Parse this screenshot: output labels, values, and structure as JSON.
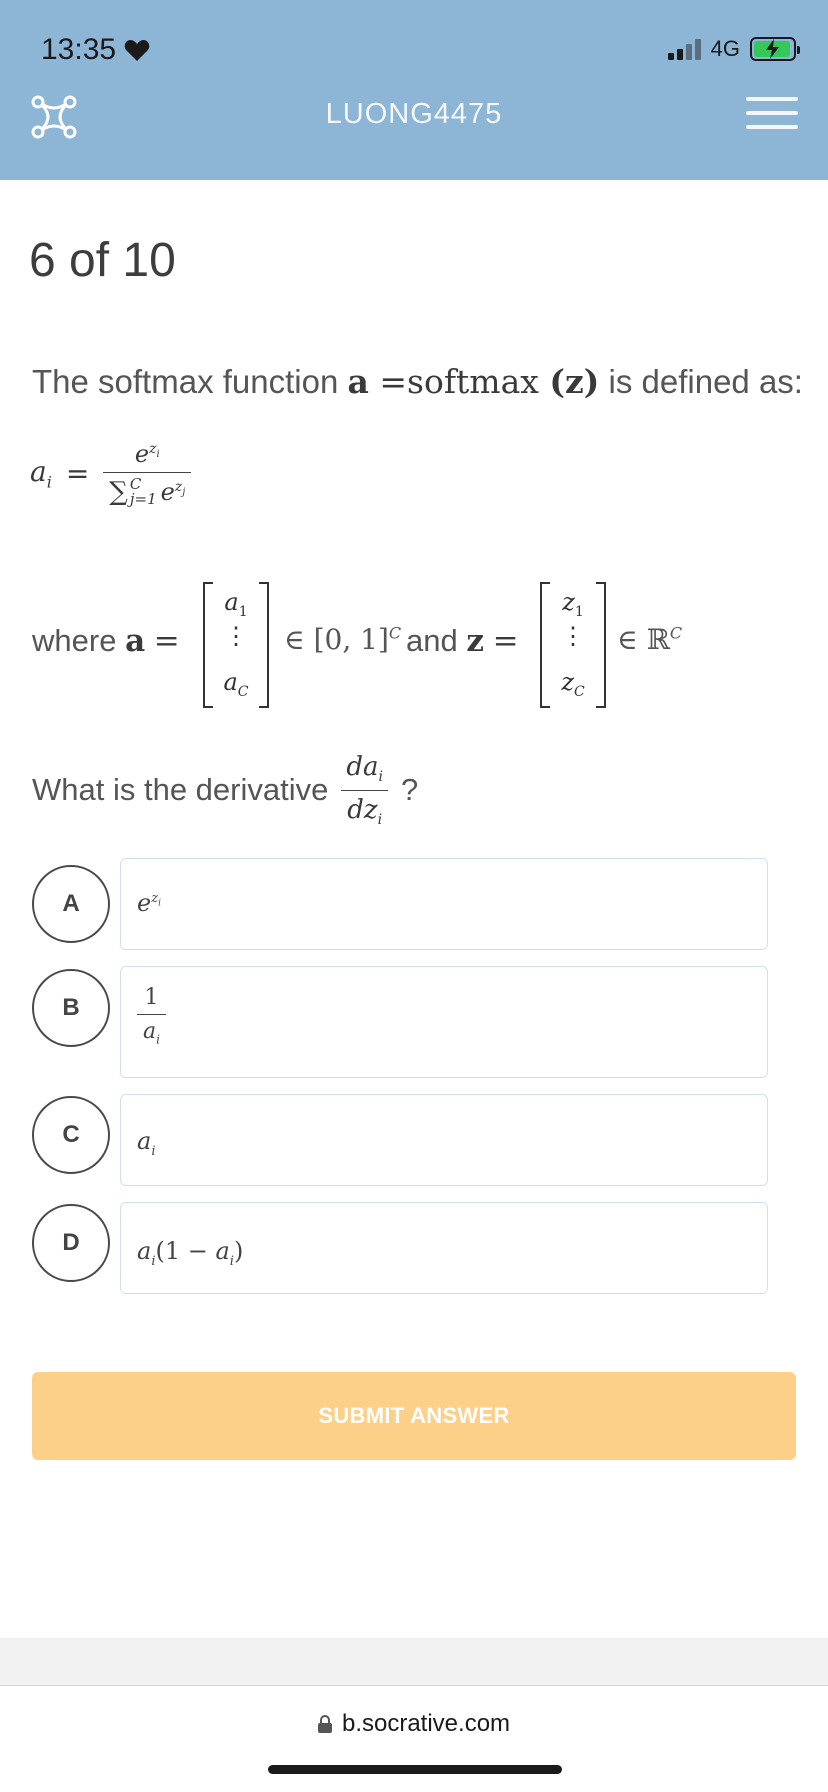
{
  "status_bar": {
    "time": "13:35",
    "network": "4G"
  },
  "header": {
    "title": "LUONG4475"
  },
  "progress_label": "6 of 10",
  "question": {
    "intro_prefix": "The softmax function ",
    "intro_a": "a",
    "intro_eq": " =softmax ",
    "intro_z": "(z)",
    "intro_suffix": " is defined as:",
    "formula_lhs": "a",
    "formula_lhs_sub": "i",
    "formula_eq": "=",
    "formula_num": "e",
    "formula_num_sup": "z",
    "formula_num_sup_sub": "i",
    "formula_sum": "∑",
    "formula_sum_top": "C",
    "formula_sum_bottom": "j=1",
    "formula_den_e": "e",
    "formula_den_sup": "z",
    "formula_den_sup_sub": "j",
    "where_text": "where",
    "where_a": "a",
    "where_eq": "=",
    "a_vec_top": "a",
    "a_vec_top_sub": "1",
    "a_vec_dots": "⋮",
    "a_vec_bottom": "a",
    "a_vec_bottom_sub": "C",
    "a_domain": "∈ [0, 1]",
    "a_domain_sup": "C",
    "and_text": "and",
    "and_z": "z",
    "and_eq": "=",
    "z_vec_top": "z",
    "z_vec_top_sub": "1",
    "z_vec_dots": "⋮",
    "z_vec_bottom": "z",
    "z_vec_bottom_sub": "C",
    "z_domain": "∈ ℝ",
    "z_domain_sup": "C",
    "deriv_prompt": "What is the derivative",
    "deriv_num": "da",
    "deriv_num_sub": "i",
    "deriv_den": "dz",
    "deriv_den_sub": "i",
    "deriv_q": "?"
  },
  "options": [
    {
      "letter": "A",
      "base": "e",
      "sup": "z",
      "sup_sub": "i"
    },
    {
      "letter": "B",
      "num": "1",
      "den": "a",
      "den_sub": "i"
    },
    {
      "letter": "C",
      "base": "a",
      "sub": "i"
    },
    {
      "letter": "D",
      "base": "a",
      "sub": "i",
      "rest1": "(1 − ",
      "rest2": "a",
      "rest2_sub": "i",
      "rest3": ")"
    }
  ],
  "submit_label": "SUBMIT ANSWER",
  "browser": {
    "url": "b.socrative.com"
  },
  "colors": {
    "header": "#8db5d6",
    "submit": "#fdd08a",
    "option_border": "#cfe0ef"
  }
}
